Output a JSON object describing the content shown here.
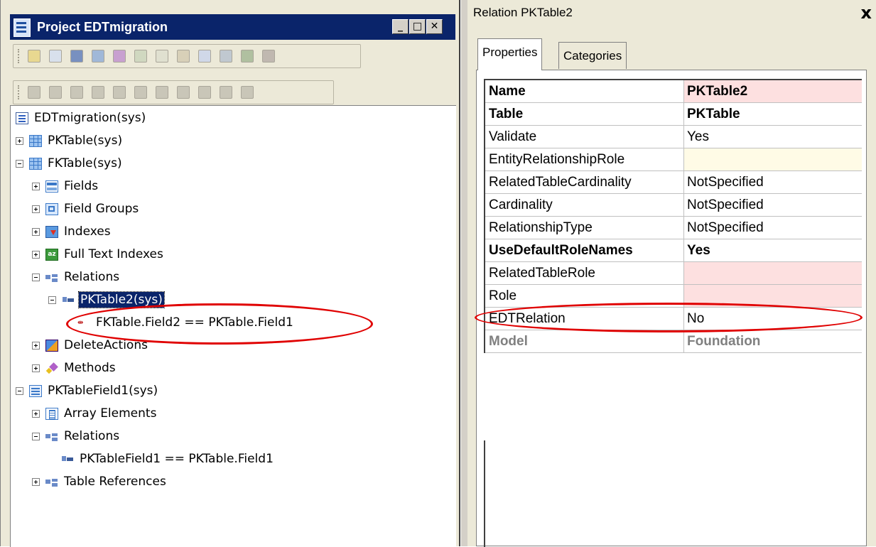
{
  "project_window": {
    "title": "Project EDTmigration",
    "min_btn": "_",
    "max_btn": "□",
    "close_btn": "✕"
  },
  "tree": {
    "root": "EDTmigration(sys)",
    "pktable": "PKTable(sys)",
    "fktable": "FKTable(sys)",
    "fields": "Fields",
    "field_groups": "Field Groups",
    "indexes": "Indexes",
    "full_text_indexes": "Full Text Indexes",
    "relations": "Relations",
    "pktable2": "PKTable2(sys)",
    "field_relation": "FKTable.Field2 == PKTable.Field1",
    "delete_actions": "DeleteActions",
    "methods": "Methods",
    "pktablefield1": "PKTableField1(sys)",
    "array_elements": "Array Elements",
    "edt_relations": "Relations",
    "edt_relation": "PKTableField1 == PKTable.Field1",
    "table_references": "Table References"
  },
  "property_window": {
    "title": "Relation PKTable2",
    "close": "x",
    "tabs": {
      "properties": "Properties",
      "categories": "Categories"
    },
    "rows": [
      {
        "name": "Name",
        "value": "PKTable2"
      },
      {
        "name": "Table",
        "value": "PKTable"
      },
      {
        "name": "Validate",
        "value": "Yes"
      },
      {
        "name": "EntityRelationshipRole",
        "value": ""
      },
      {
        "name": "RelatedTableCardinality",
        "value": "NotSpecified"
      },
      {
        "name": "Cardinality",
        "value": "NotSpecified"
      },
      {
        "name": "RelationshipType",
        "value": "NotSpecified"
      },
      {
        "name": "UseDefaultRoleNames",
        "value": "Yes"
      },
      {
        "name": "RelatedTableRole",
        "value": ""
      },
      {
        "name": "Role",
        "value": ""
      },
      {
        "name": "EDTRelation",
        "value": "No"
      },
      {
        "name": "Model",
        "value": "Foundation"
      }
    ]
  },
  "colors": {
    "title_bar": "#0a246a",
    "annotation": "#e00000",
    "required_field": "#fde0e0",
    "optional_field": "#fffbe6"
  }
}
